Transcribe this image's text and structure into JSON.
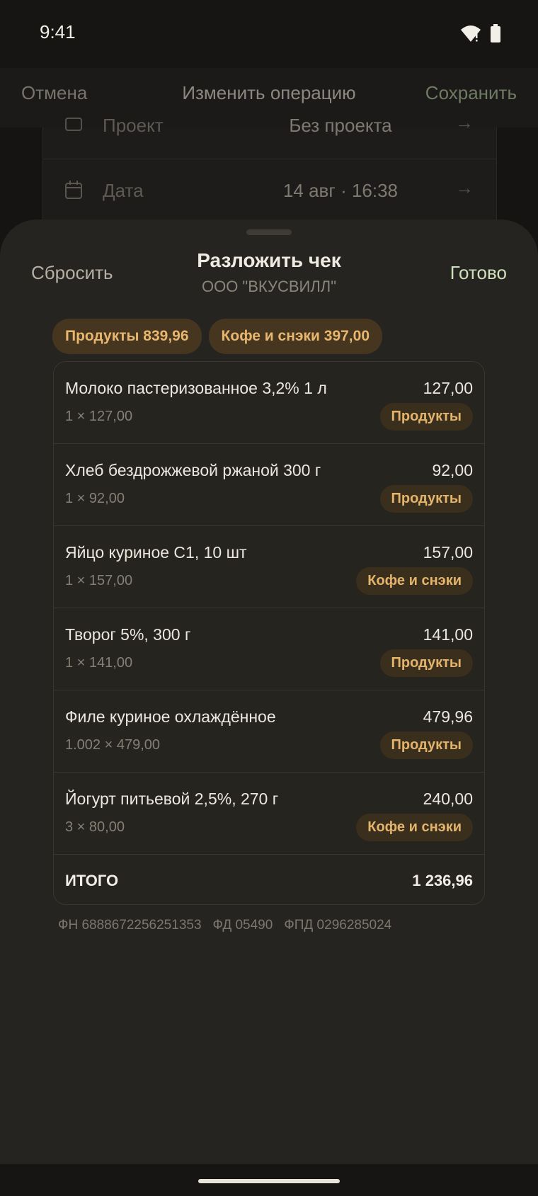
{
  "status": {
    "time": "9:41"
  },
  "top_bar": {
    "cancel": "Отмена",
    "title": "Изменить операцию",
    "save": "Сохранить"
  },
  "background_form": {
    "project_row": {
      "label": "Проект",
      "value": "Без проекта"
    },
    "date_row": {
      "label": "Дата",
      "value": "14 авг · 16:38"
    }
  },
  "sheet": {
    "reset": "Сбросить",
    "title": "Разложить чек",
    "subtitle": "ООО \"ВКУСВИЛЛ\"",
    "done": "Готово",
    "chips": [
      "Продукты 839,96",
      "Кофе и снэки 397,00"
    ],
    "items": [
      {
        "name": "Молоко пастеризованное 3,2% 1 л",
        "qty": "1 × 127,00",
        "price": "127,00",
        "category": "Продукты"
      },
      {
        "name": "Хлеб бездрожжевой ржаной 300 г",
        "qty": "1 × 92,00",
        "price": "92,00",
        "category": "Продукты"
      },
      {
        "name": "Яйцо куриное С1, 10 шт",
        "qty": "1 × 157,00",
        "price": "157,00",
        "category": "Кофе и снэки"
      },
      {
        "name": "Творог 5%, 300 г",
        "qty": "1 × 141,00",
        "price": "141,00",
        "category": "Продукты"
      },
      {
        "name": "Филе куриное охлаждённое",
        "qty": "1.002 × 479,00",
        "price": "479,96",
        "category": "Продукты"
      },
      {
        "name": "Йогурт питьевой 2,5%, 270 г",
        "qty": "3 × 80,00",
        "price": "240,00",
        "category": "Кофе и снэки"
      }
    ],
    "total_label": "ИТОГО",
    "total_value": "1 236,96",
    "fiscal": {
      "fn": "ФН 6888672256251353",
      "fd": "ФД 05490",
      "fpd": "ФПД 0296285024"
    }
  },
  "colors": {
    "accent_done": "#cfe0bd",
    "chip_text": "#e8b66e",
    "sheet_bg": "#262420"
  }
}
